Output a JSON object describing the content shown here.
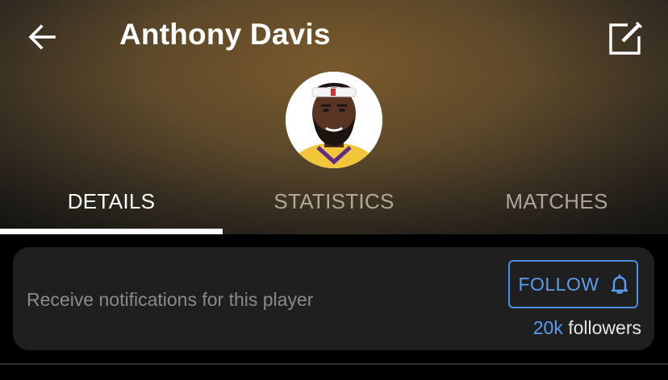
{
  "header": {
    "title": "Anthony Davis",
    "back_icon": "arrow-left-icon",
    "edit_icon": "edit-icon"
  },
  "player": {
    "avatar_icon": "player-avatar"
  },
  "tabs": [
    {
      "label": "DETAILS",
      "active": true
    },
    {
      "label": "STATISTICS",
      "active": false
    },
    {
      "label": "MATCHES",
      "active": false
    }
  ],
  "notification_card": {
    "text": "Receive notifications for this player",
    "follow_label": "FOLLOW",
    "follow_icon": "bell-icon",
    "followers_count": "20k",
    "followers_label": "followers"
  },
  "colors": {
    "accent": "#5b9cf0",
    "card_bg": "#1f1f1f",
    "background": "#000000"
  }
}
